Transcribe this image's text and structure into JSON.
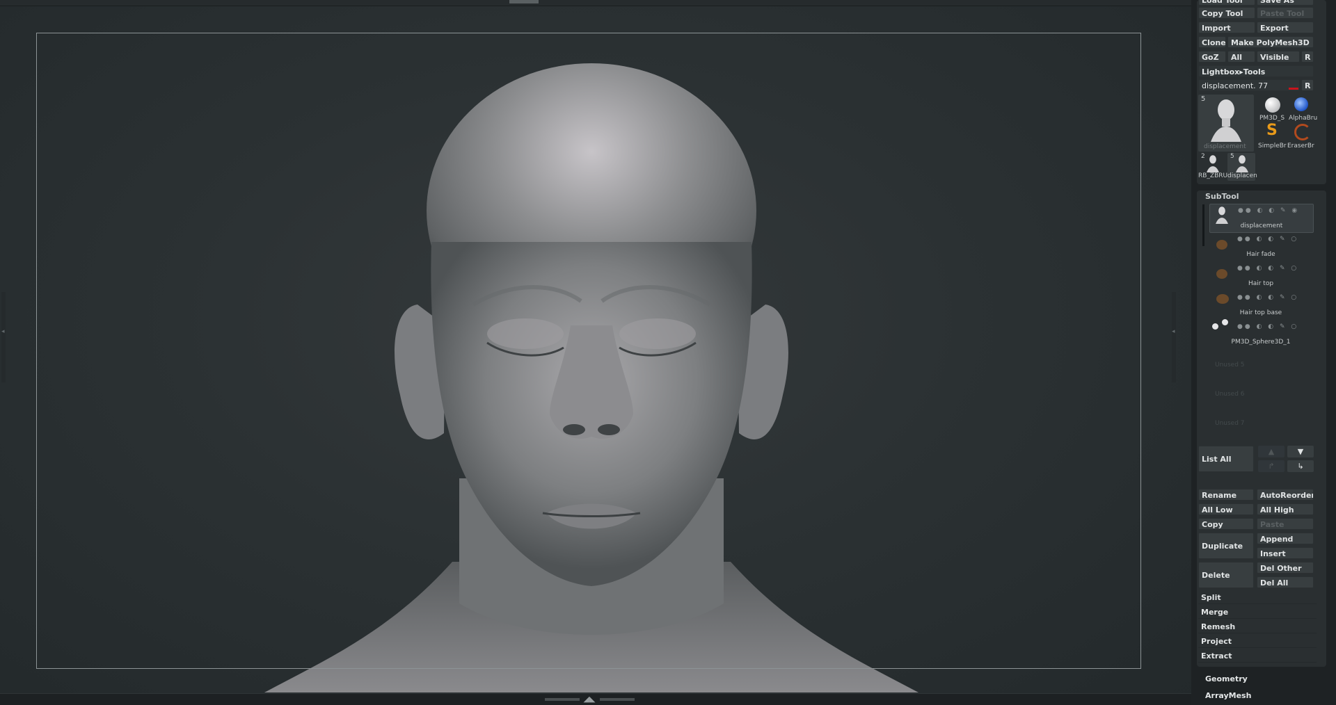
{
  "tool_panel": {
    "load_tool": "Load Tool",
    "save_as": "Save As",
    "copy_tool": "Copy Tool",
    "paste_tool": "Paste Tool",
    "import": "Import",
    "export": "Export",
    "clone": "Clone",
    "make_polymesh": "Make PolyMesh3D",
    "goz": "GoZ",
    "all": "All",
    "visible": "Visible",
    "r": "R",
    "lightbox_tools": "Lightbox▸Tools",
    "current_tool": "displacement. 77",
    "current_tool_r": "R",
    "main_thumb_count": "5",
    "main_thumb_label": "displacement",
    "thumbs": [
      {
        "label": "PM3D_S",
        "icon": "sphere-icon"
      },
      {
        "label": "AlphaBru",
        "icon": "alpha-brush-icon"
      },
      {
        "label": "SimpleBr",
        "icon": "simple-brush-icon"
      },
      {
        "label": "EraserBr",
        "icon": "eraser-brush-icon"
      }
    ],
    "small_thumbs": [
      {
        "count": "2",
        "label": "RB_ZBRU"
      },
      {
        "count": "5",
        "label": "displacen"
      }
    ]
  },
  "subtool": {
    "title": "SubTool",
    "items": [
      {
        "name": "displacement",
        "active": true
      },
      {
        "name": "Hair  fade",
        "active": false
      },
      {
        "name": "Hair  top",
        "active": false
      },
      {
        "name": "Hair  top  base",
        "active": false
      },
      {
        "name": "PM3D_Sphere3D_1",
        "active": false
      }
    ],
    "unused": [
      "Unused  5",
      "Unused  6",
      "Unused  7"
    ],
    "list_all": "List All",
    "rename": "Rename",
    "autoreorder": "AutoReorder",
    "all_low": "All Low",
    "all_high": "All High",
    "copy": "Copy",
    "paste": "Paste",
    "duplicate": "Duplicate",
    "append": "Append",
    "insert": "Insert",
    "delete": "Delete",
    "del_other": "Del Other",
    "del_all": "Del All",
    "split": "Split",
    "merge": "Merge",
    "remesh": "Remesh",
    "project": "Project",
    "extract": "Extract"
  },
  "sections": {
    "geometry": "Geometry",
    "arraymesh": "ArrayMesh"
  },
  "colors": {
    "viewport_bg": "#2b3133",
    "panel_bg": "#1e2224",
    "button_bg": "#383e40",
    "active_accent": "#d0d4d6",
    "red_marker": "#c8141c"
  }
}
